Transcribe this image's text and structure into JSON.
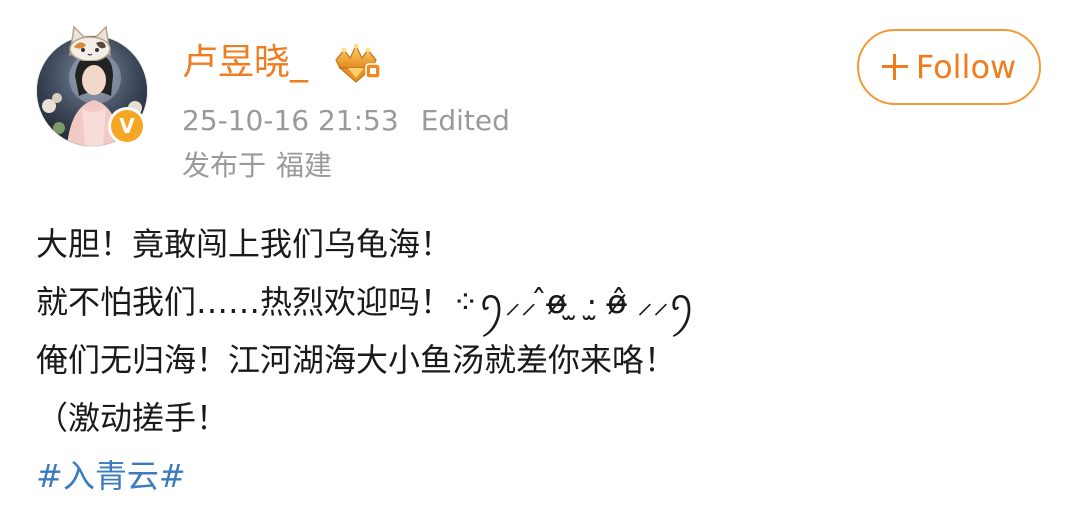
{
  "author": {
    "name": "卢昱晓_",
    "verified_mark": "V",
    "avatar_icon": "avatar-photo",
    "vip_icon": "crown-badge-icon"
  },
  "meta": {
    "timestamp": "25-10-16 21:53",
    "edited_label": "Edited",
    "location_prefix": "发布于",
    "location": "福建"
  },
  "follow_button": {
    "label": "Follow",
    "icon": "plus-icon"
  },
  "post": {
    "lines": [
      "大胆！竟敢闯上我们乌龟海！",
      "就不怕我们……热烈欢迎吗！⁘ꪆ⸝⸝ ̂ø̶ ̫ ·̫ ø̶̂ ⸝⸝ꪆ",
      "俺们无归海！江河湖海大小鱼汤就差你来咯！",
      "（激动搓手！"
    ],
    "hashtag": "#入青云#"
  },
  "colors": {
    "accent": "#f07c1e",
    "meta_text": "#9a9a9a",
    "body_text": "#1a1a1a",
    "hashtag": "#3b7bbf",
    "verify_badge": "#f5a623"
  }
}
